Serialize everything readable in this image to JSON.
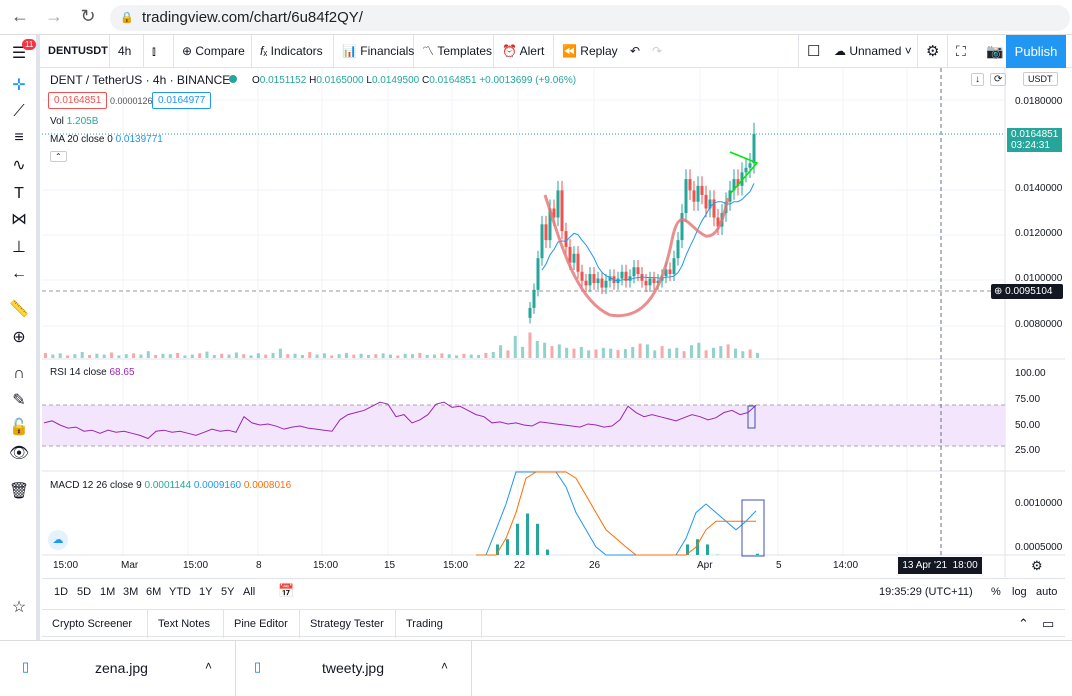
{
  "browser": {
    "url": "tradingview.com/chart/6u84f2QY/"
  },
  "toolbar": {
    "symbol": "DENTUSDT",
    "interval": "4h",
    "compare": "Compare",
    "indicators": "Indicators",
    "financials": "Financials",
    "templates": "Templates",
    "alert": "Alert",
    "replay": "Replay",
    "layout_name": "Unnamed",
    "publish": "Publish",
    "notif_count": "11"
  },
  "legend": {
    "title": "DENT / TetherUS · 4h · BINANCE",
    "o_label": "O",
    "o": "0.0151152",
    "h_label": "H",
    "h": "0.0165000",
    "l_label": "L",
    "l": "0.0149500",
    "c_label": "C",
    "c": "0.0164851",
    "change": "+0.0013699 (+9.06%)",
    "bid": "0.0164851",
    "spread": "0.0000126",
    "ask": "0.0164977",
    "vol_label": "Vol",
    "vol": "1.205B",
    "ma_label": "MA 20 close 0",
    "ma": "0.0139771"
  },
  "price_axis": {
    "currency": "USDT",
    "ticks": [
      "0.0180000",
      "0.0140000",
      "0.0120000",
      "0.0100000",
      "0.0080000"
    ],
    "last_price": "0.0164851",
    "countdown": "03:24:31",
    "crosshair_price": "0.0095104"
  },
  "rsi": {
    "label": "RSI 14 close",
    "value": "68.65",
    "ticks": [
      "100.00",
      "75.00",
      "50.00",
      "25.00"
    ]
  },
  "macd": {
    "label": "MACD 12 26 close 9",
    "hist": "0.0001144",
    "macd": "0.0009160",
    "signal": "0.0008016",
    "ticks": [
      "0.0010000",
      "0.0005000"
    ]
  },
  "time_axis": {
    "ticks": [
      "15:00",
      "Mar",
      "15:00",
      "8",
      "15:00",
      "15",
      "15:00",
      "22",
      "26",
      "Apr",
      "5",
      "14:00"
    ],
    "crosshair_time": "13 Apr '21  18:00"
  },
  "range_bar": {
    "ranges": [
      "1D",
      "5D",
      "1M",
      "3M",
      "6M",
      "YTD",
      "1Y",
      "5Y",
      "All"
    ],
    "clock": "19:35:29 (UTC+11)",
    "pct": "%",
    "log": "log",
    "auto": "auto"
  },
  "bottom_panel": {
    "tabs": [
      "Crypto Screener",
      "Text Notes",
      "Pine Editor",
      "Strategy Tester",
      "Trading Panel"
    ]
  },
  "downloads": [
    {
      "name": "zena.jpg"
    },
    {
      "name": "tweety.jpg"
    }
  ],
  "colors": {
    "up": "#26a69a",
    "down": "#ef5350",
    "accent": "#2196f3",
    "rsi": "#9c27b0",
    "macd": "#2196f3",
    "signal": "#ff6d00"
  },
  "chart_data": {
    "type": "candlestick",
    "closes": [
      0.0088,
      0.0096,
      0.011,
      0.0125,
      0.0118,
      0.0132,
      0.0128,
      0.014,
      0.0122,
      0.0115,
      0.0108,
      0.0112,
      0.0104,
      0.01,
      0.0098,
      0.0103,
      0.0099,
      0.0101,
      0.0097,
      0.01,
      0.0102,
      0.0099,
      0.0101,
      0.0104,
      0.01,
      0.0102,
      0.0106,
      0.0103,
      0.01,
      0.0098,
      0.0101,
      0.0099,
      0.01,
      0.0102,
      0.0105,
      0.0103,
      0.011,
      0.0118,
      0.013,
      0.0145,
      0.014,
      0.0135,
      0.0142,
      0.0138,
      0.0132,
      0.0136,
      0.0128,
      0.0124,
      0.013,
      0.0135,
      0.014,
      0.0145,
      0.0142,
      0.0148,
      0.015,
      0.0152,
      0.0165
    ],
    "ylim": [
      0.0075,
      0.0185
    ],
    "volume": [
      60,
      40,
      55,
      30,
      45,
      70,
      35,
      50,
      40,
      65,
      30,
      45,
      55,
      40,
      80,
      35,
      50,
      45,
      60,
      30,
      40,
      55,
      75,
      35,
      50,
      40,
      65,
      45,
      30,
      55,
      40,
      60,
      110,
      45,
      50,
      35,
      70,
      40,
      55,
      30,
      45,
      60,
      40,
      50,
      35,
      45,
      55,
      40,
      30,
      50,
      45,
      60,
      35,
      40,
      55,
      45,
      30,
      50,
      40,
      35,
      60,
      70,
      150,
      90,
      260,
      130,
      300,
      200,
      180,
      140,
      160,
      120,
      110,
      130,
      90,
      100,
      120,
      110,
      95,
      105,
      130,
      170,
      160,
      90,
      140,
      110,
      120,
      80,
      150,
      180,
      90,
      120,
      140,
      160,
      110,
      80,
      100,
      60
    ],
    "rsi": [
      52,
      54,
      50,
      47,
      48,
      44,
      45,
      42,
      45,
      43,
      44,
      42,
      40,
      37,
      44,
      45,
      43,
      44,
      42,
      40,
      43,
      46,
      44,
      45,
      43,
      58,
      52,
      50,
      51,
      49,
      46,
      48,
      49,
      47,
      46,
      45,
      44,
      55,
      60,
      62,
      64,
      68,
      72,
      70,
      58,
      60,
      52,
      55,
      60,
      70,
      72,
      67,
      68,
      64,
      60,
      58,
      52,
      53,
      51,
      52,
      50,
      49,
      53,
      52,
      51,
      50,
      49,
      48,
      51,
      50,
      48,
      49,
      55,
      68,
      62,
      58,
      60,
      58,
      56,
      54,
      57,
      60,
      58,
      55,
      57,
      62,
      64,
      60,
      62,
      69
    ],
    "macd": [
      0.0003,
      0.0004,
      0.0007,
      0.001,
      0.0016,
      0.0022,
      0.0024,
      0.002,
      0.0016,
      0.0012,
      0.0009,
      0.0007,
      0.0005,
      0.0004,
      0.0003,
      0.0002,
      0.0001,
      0.0,
      0.0,
      0.0001,
      0.0003,
      0.0006,
      0.0009,
      0.001,
      0.0009,
      0.0008,
      0.0007,
      0.0008,
      0.00092
    ],
    "signal": [
      0.0002,
      0.0003,
      0.0004,
      0.0006,
      0.0009,
      0.0013,
      0.0017,
      0.0018,
      0.0017,
      0.0015,
      0.0013,
      0.0011,
      0.0009,
      0.0007,
      0.0006,
      0.0005,
      0.0004,
      0.0003,
      0.0002,
      0.0002,
      0.0002,
      0.0003,
      0.0005,
      0.0007,
      0.0008,
      0.0008,
      0.0008,
      0.0008,
      0.0008
    ]
  }
}
